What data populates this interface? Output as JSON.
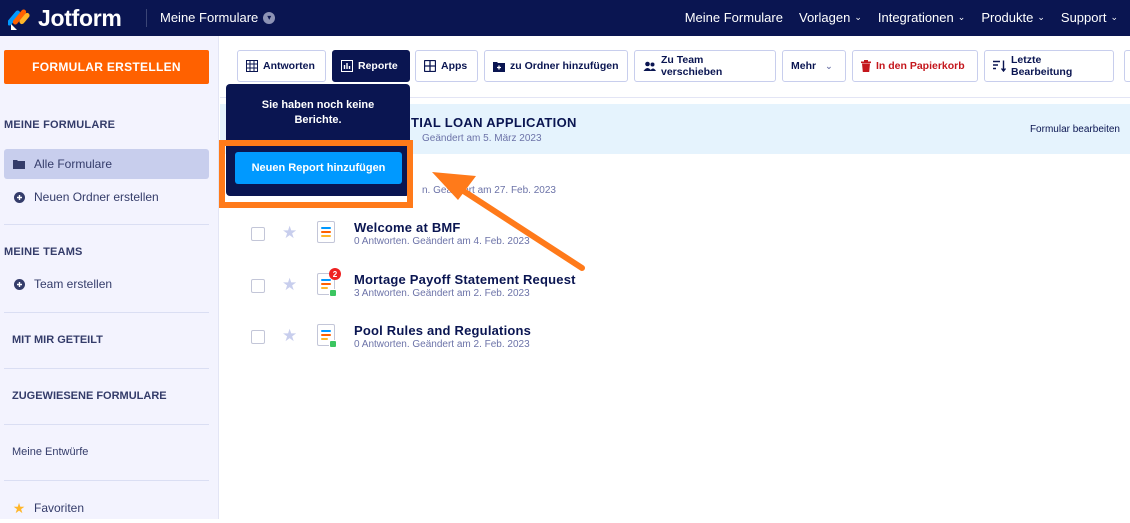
{
  "brand": {
    "name": "Jotform"
  },
  "topnav": {
    "my_forms": "Meine Formulare",
    "links": [
      {
        "label": "Meine Formulare",
        "chevron": false
      },
      {
        "label": "Vorlagen",
        "chevron": true
      },
      {
        "label": "Integrationen",
        "chevron": true
      },
      {
        "label": "Produkte",
        "chevron": true
      },
      {
        "label": "Support",
        "chevron": true
      }
    ]
  },
  "sidebar": {
    "create_button": "FORMULAR ERSTELLEN",
    "my_forms_heading": "MEINE FORMULARE",
    "all_forms": "Alle Formulare",
    "new_folder": "Neuen Ordner erstellen",
    "my_teams_heading": "MEINE TEAMS",
    "create_team": "Team erstellen",
    "shared_with_me": "MIT MIR GETEILT",
    "assigned_forms": "ZUGEWIESENE FORMULARE",
    "my_drafts": "Meine Entwürfe",
    "favorites": "Favoriten"
  },
  "toolbar": {
    "answers": "Antworten",
    "reports": "Reporte",
    "apps": "Apps",
    "add_to_folder": "zu Ordner hinzufügen",
    "move_to_team": "Zu Team verschieben",
    "more": "Mehr",
    "trash": "In den Papierkorb",
    "last_edit": "Letzte Bearbeitung"
  },
  "popover": {
    "message": "Sie haben noch keine Berichte.",
    "button": "Neuen Report hinzufügen"
  },
  "selected_form": {
    "title_fragment": "TIAL LOAN APPLICATION",
    "meta_fragment": "Geändert am 5. März 2023",
    "edit_link": "Formular bearbeiten"
  },
  "second_form": {
    "meta_fragment": "n. Geändert am 27. Feb. 2023"
  },
  "forms": [
    {
      "title": "Welcome at BMF",
      "meta": "0 Antworten. Geändert am 4. Feb. 2023",
      "badge": "",
      "green": false
    },
    {
      "title": "Mortage Payoff Statement Request",
      "meta": "3 Antworten. Geändert am 2. Feb. 2023",
      "badge": "2",
      "green": true
    },
    {
      "title": "Pool Rules and Regulations",
      "meta": "0 Antworten. Geändert am 2. Feb. 2023",
      "badge": "",
      "green": true
    }
  ],
  "colors": {
    "navy": "#0a1551",
    "orange": "#ff6100",
    "blue_button": "#0099ff",
    "annotation_orange": "#ff7a1a"
  }
}
